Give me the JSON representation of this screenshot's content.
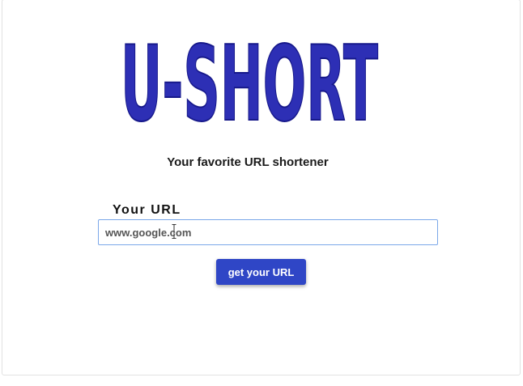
{
  "logo": {
    "text": "U-SHORT",
    "color": "#2d2fb5",
    "outline_color": "#16188a"
  },
  "tagline": "Your favorite URL shortener",
  "form": {
    "url_label": "Your URL",
    "url_value": "www.google.com",
    "submit_label": "get your URL"
  },
  "colors": {
    "button": "#2f46c6",
    "input_border": "#7aa7e9"
  },
  "icons": {
    "cursor": "text-cursor-icon"
  }
}
